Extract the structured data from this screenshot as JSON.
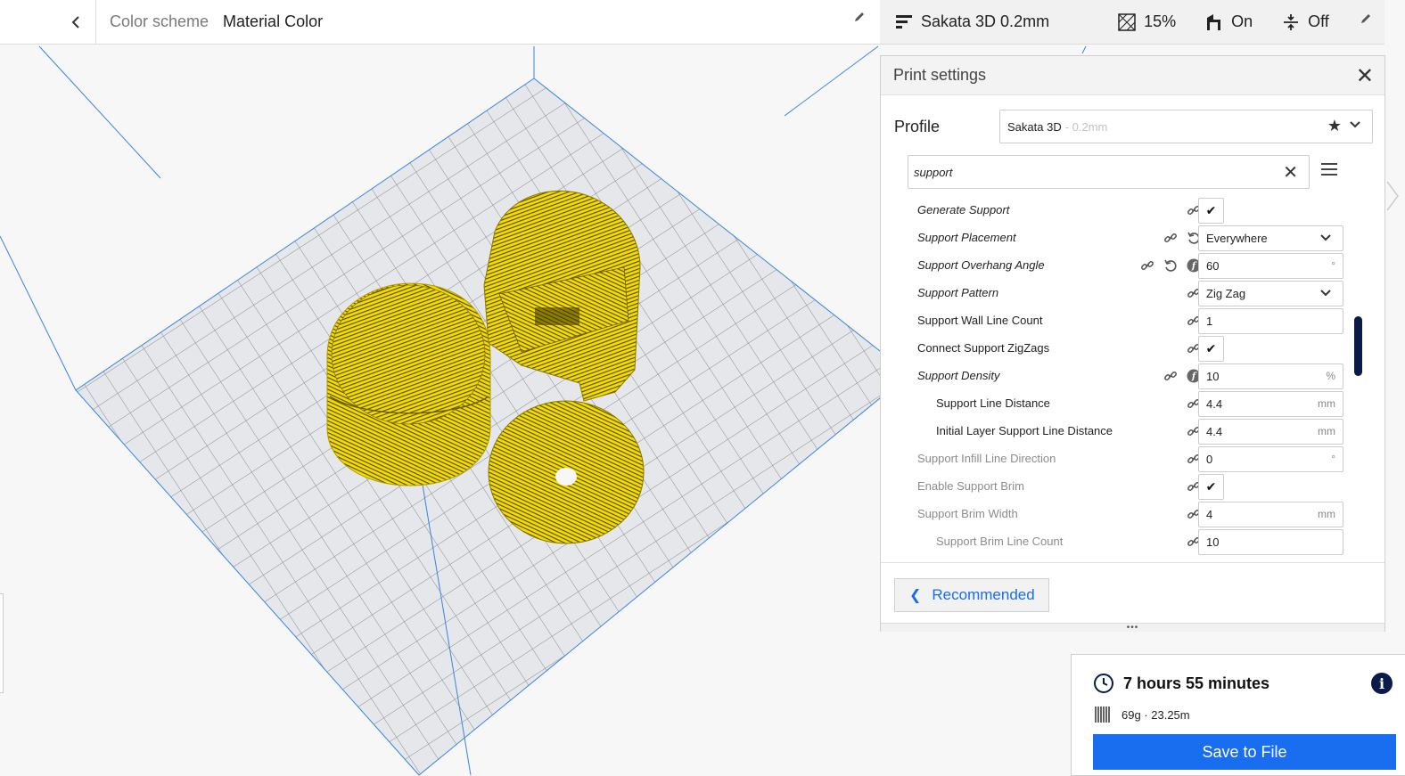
{
  "header": {
    "back_icon": "chevron-left-icon",
    "color_scheme_label": "Color scheme",
    "color_scheme_value": "Material Color"
  },
  "printer_bar": {
    "profile_name": "Sakata 3D 0.2mm",
    "infill": "15%",
    "support": "On",
    "adhesion": "Off"
  },
  "print_settings": {
    "title": "Print settings",
    "profile_label": "Profile",
    "profile_value": "Sakata 3D",
    "profile_suffix": "- 0.2mm",
    "search_value": "support",
    "settings": [
      {
        "label": "Generate Support",
        "control": "check",
        "value": "✔",
        "italic": true,
        "indent": 0,
        "dim": false,
        "icons": [
          "link"
        ]
      },
      {
        "label": "Support Placement",
        "control": "select",
        "value": "Everywhere",
        "italic": true,
        "indent": 0,
        "dim": false,
        "icons": [
          "link",
          "reset"
        ]
      },
      {
        "label": "Support Overhang Angle",
        "control": "number",
        "value": "60",
        "unit": "°",
        "italic": true,
        "indent": 0,
        "dim": false,
        "icons": [
          "link",
          "reset",
          "formula"
        ]
      },
      {
        "label": "Support Pattern",
        "control": "select",
        "value": "Zig Zag",
        "italic": true,
        "indent": 0,
        "dim": false,
        "icons": [
          "link"
        ]
      },
      {
        "label": "Support Wall Line Count",
        "control": "number",
        "value": "1",
        "unit": "",
        "italic": false,
        "indent": 0,
        "dim": false,
        "icons": [
          "link"
        ]
      },
      {
        "label": "Connect Support ZigZags",
        "control": "check",
        "value": "✔",
        "italic": false,
        "indent": 0,
        "dim": false,
        "icons": [
          "link"
        ]
      },
      {
        "label": "Support Density",
        "control": "number",
        "value": "10",
        "unit": "%",
        "italic": true,
        "indent": 0,
        "dim": false,
        "icons": [
          "link",
          "formula"
        ]
      },
      {
        "label": "Support Line Distance",
        "control": "number",
        "value": "4.4",
        "unit": "mm",
        "italic": false,
        "indent": 1,
        "dim": false,
        "icons": [
          "link"
        ]
      },
      {
        "label": "Initial Layer Support Line Distance",
        "control": "number",
        "value": "4.4",
        "unit": "mm",
        "italic": false,
        "indent": 1,
        "dim": false,
        "icons": [
          "link"
        ]
      },
      {
        "label": "Support Infill Line Direction",
        "control": "number",
        "value": "0",
        "unit": "°",
        "italic": false,
        "indent": 0,
        "dim": true,
        "icons": [
          "link"
        ]
      },
      {
        "label": "Enable Support Brim",
        "control": "check",
        "value": "✔",
        "italic": false,
        "indent": 0,
        "dim": true,
        "icons": [
          "link"
        ]
      },
      {
        "label": "Support Brim Width",
        "control": "number",
        "value": "4",
        "unit": "mm",
        "italic": false,
        "indent": 0,
        "dim": true,
        "icons": [
          "link"
        ]
      },
      {
        "label": "Support Brim Line Count",
        "control": "number",
        "value": "10",
        "unit": "",
        "italic": false,
        "indent": 1,
        "dim": true,
        "icons": [
          "link"
        ]
      }
    ],
    "recommended_label": "Recommended"
  },
  "summary": {
    "time": "7 hours 55 minutes",
    "material": "69g · 23.25m",
    "save_label": "Save to File"
  },
  "colors": {
    "accent": "#196ef0",
    "dark_navy": "#0a1a4a",
    "model_yellow": "#f2d800"
  }
}
